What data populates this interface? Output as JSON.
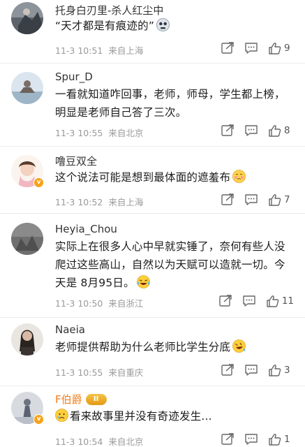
{
  "comments": [
    {
      "user": "托身白刃里-杀人红尘中",
      "text": "“天才都是有痕迹的”",
      "emoji": "skull-emoji",
      "time": "11-3 10:51",
      "location": "来自上海",
      "likes": "9"
    },
    {
      "user": "Spur_D",
      "text": "一看就知道咋回事，老师，师母，学生都上榜，明显是老师自己答了三次。",
      "time": "11-3 10:55",
      "location": "来自北京",
      "likes": "8"
    },
    {
      "user": "噜豆双全",
      "text": "这个说法可能是想到最体面的遮羞布",
      "emoji": "embarrassed-emoji",
      "time": "11-3 10:52",
      "location": "来自上海",
      "likes": "7",
      "verified": "v"
    },
    {
      "user": "Heyia_Chou",
      "text": "实际上在很多人心中早就实锤了，奈何有些人没爬过这些高山，自然以为天赋可以造就一切。今天是 8月95日。",
      "emoji": "laugh-cry-emoji",
      "time": "11-3 10:50",
      "location": "来自浙江",
      "likes": "11"
    },
    {
      "user": "Naeia",
      "text": "老师提供帮助为什么老师比学生分底",
      "emoji": "rofl-emoji",
      "time": "11-3 10:55",
      "location": "来自重庆",
      "likes": "3"
    },
    {
      "user": "F伯爵",
      "vip_level": "II",
      "text": "看来故事里并没有奇迹发生...",
      "emoji": "sad-emoji",
      "time": "11-3 10:54",
      "location": "来自北京",
      "likes": "1",
      "verified": "v"
    }
  ],
  "colors": {
    "name": "#333333",
    "vip_name": "#f0801f",
    "meta": "#9a9a9a",
    "divider": "#ececec"
  }
}
